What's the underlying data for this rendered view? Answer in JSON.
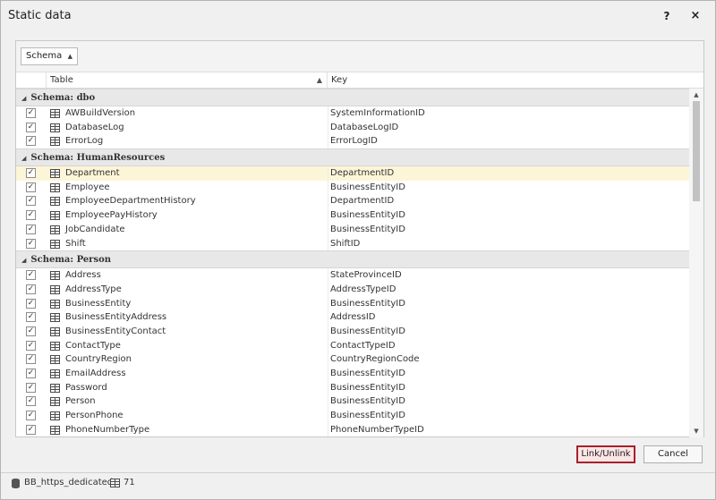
{
  "window": {
    "title": "Static data",
    "help_label": "?",
    "close_label": "×"
  },
  "grouping": {
    "chip_label": "Schema"
  },
  "columns": {
    "table": "Table",
    "key": "Key"
  },
  "groups": [
    {
      "label": "Schema: dbo",
      "rows": [
        {
          "table": "AWBuildVersion",
          "key": "SystemInformationID",
          "checked": true
        },
        {
          "table": "DatabaseLog",
          "key": "DatabaseLogID",
          "checked": true
        },
        {
          "table": "ErrorLog",
          "key": "ErrorLogID",
          "checked": true
        }
      ]
    },
    {
      "label": "Schema: HumanResources",
      "rows": [
        {
          "table": "Department",
          "key": "DepartmentID",
          "checked": true,
          "selected": true
        },
        {
          "table": "Employee",
          "key": "BusinessEntityID",
          "checked": true
        },
        {
          "table": "EmployeeDepartmentHistory",
          "key": "DepartmentID",
          "checked": true
        },
        {
          "table": "EmployeePayHistory",
          "key": "BusinessEntityID",
          "checked": true
        },
        {
          "table": "JobCandidate",
          "key": "BusinessEntityID",
          "checked": true
        },
        {
          "table": "Shift",
          "key": "ShiftID",
          "checked": true
        }
      ]
    },
    {
      "label": "Schema: Person",
      "rows": [
        {
          "table": "Address",
          "key": "StateProvinceID",
          "checked": true
        },
        {
          "table": "AddressType",
          "key": "AddressTypeID",
          "checked": true
        },
        {
          "table": "BusinessEntity",
          "key": "BusinessEntityID",
          "checked": true
        },
        {
          "table": "BusinessEntityAddress",
          "key": "AddressID",
          "checked": true
        },
        {
          "table": "BusinessEntityContact",
          "key": "BusinessEntityID",
          "checked": true
        },
        {
          "table": "ContactType",
          "key": "ContactTypeID",
          "checked": true
        },
        {
          "table": "CountryRegion",
          "key": "CountryRegionCode",
          "checked": true
        },
        {
          "table": "EmailAddress",
          "key": "BusinessEntityID",
          "checked": true
        },
        {
          "table": "Password",
          "key": "BusinessEntityID",
          "checked": true
        },
        {
          "table": "Person",
          "key": "BusinessEntityID",
          "checked": true
        },
        {
          "table": "PersonPhone",
          "key": "BusinessEntityID",
          "checked": true
        },
        {
          "table": "PhoneNumberType",
          "key": "PhoneNumberTypeID",
          "checked": true
        }
      ]
    }
  ],
  "buttons": {
    "link_unlink": "Link/Unlink",
    "cancel": "Cancel"
  },
  "status": {
    "connection": "BB_https_dedicated",
    "table_count": "71"
  },
  "icons": {
    "collapse": "triangle-down-icon",
    "sort": "sort-ascending-icon",
    "table": "table-icon",
    "database": "database-icon"
  },
  "colors": {
    "accent_border": "#a5212b",
    "selected_row": "#fdf5d8"
  }
}
